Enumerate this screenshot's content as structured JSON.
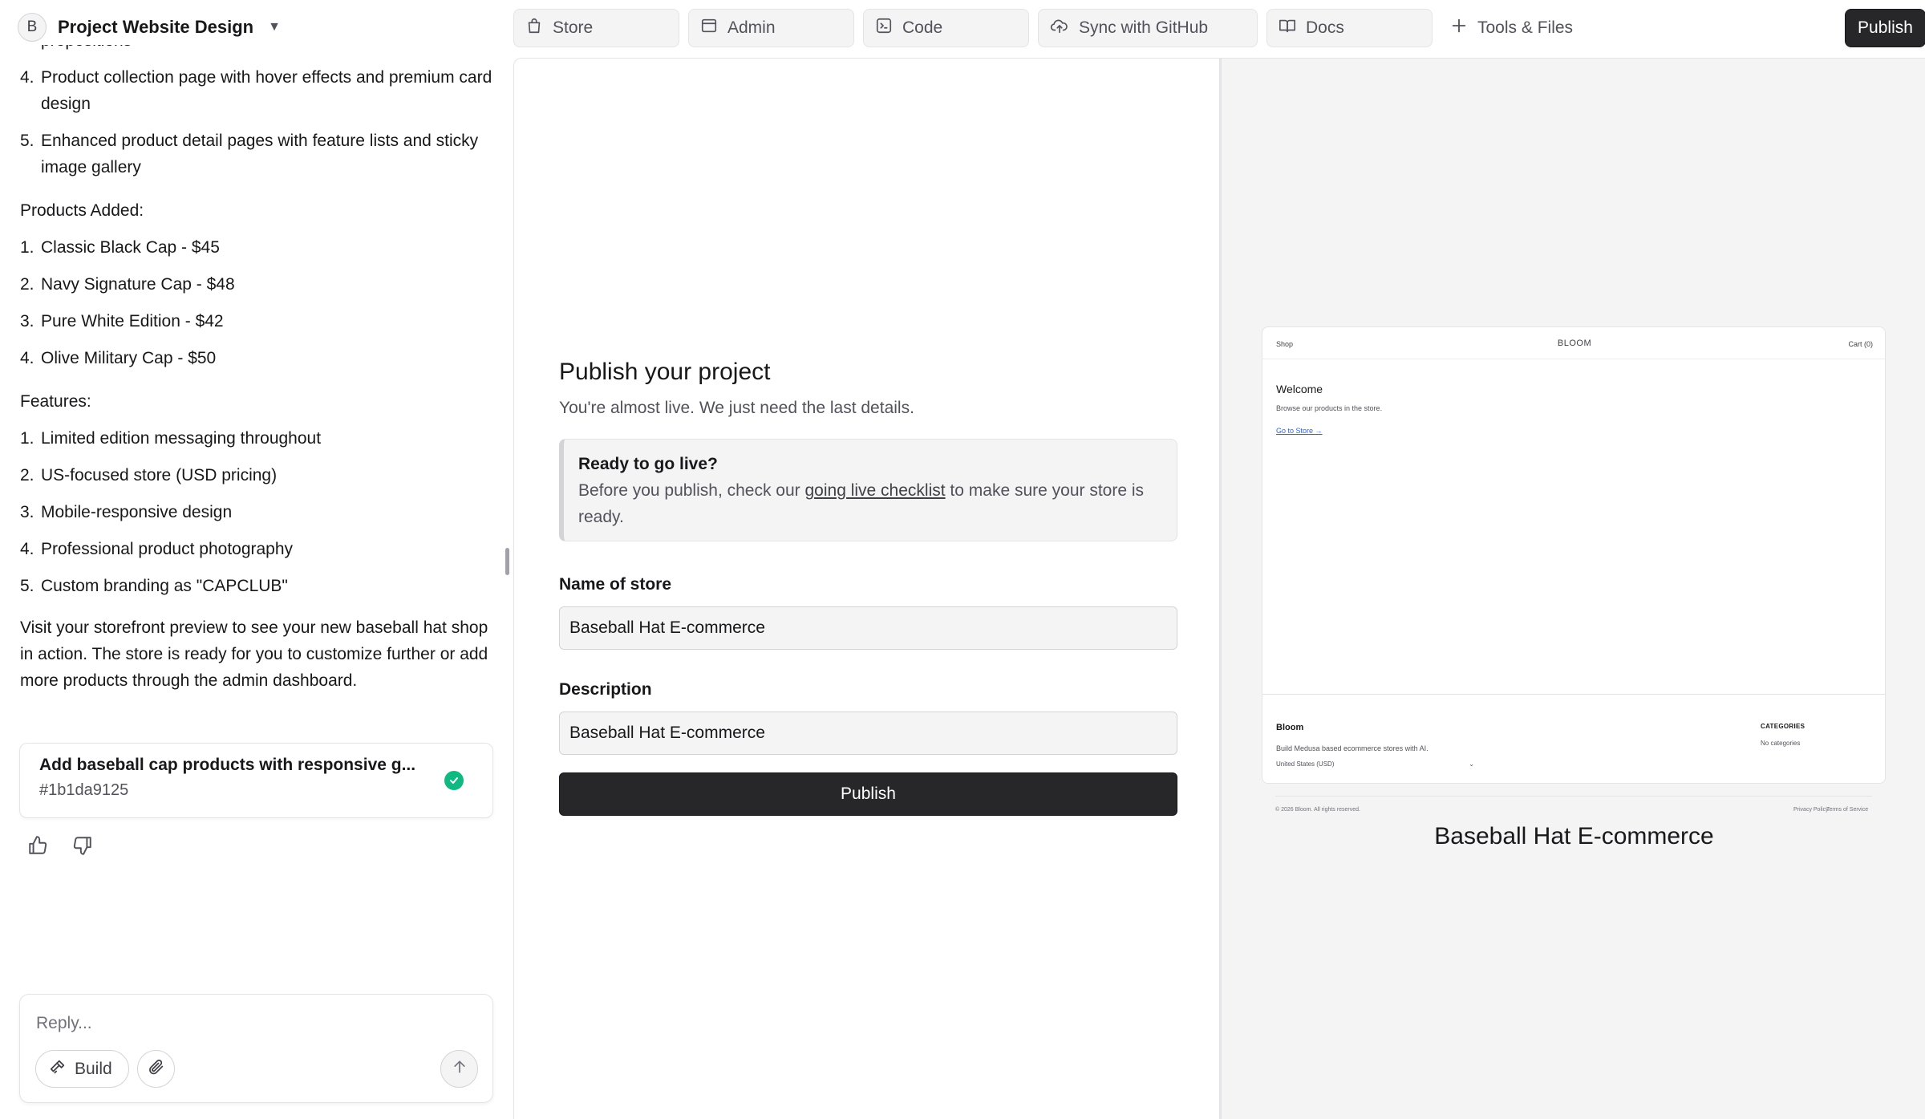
{
  "project": {
    "avatar_initial": "B",
    "title": "Project Website Design"
  },
  "chat": {
    "list_a": [
      {
        "num": "",
        "text": "propositions"
      },
      {
        "num": "4.",
        "text": "Product collection page with hover effects and premium card design"
      },
      {
        "num": "5.",
        "text": "Enhanced product detail pages with feature lists and sticky image gallery"
      }
    ],
    "products_heading": "Products Added:",
    "products": [
      {
        "num": "1.",
        "text": "Classic Black Cap - $45"
      },
      {
        "num": "2.",
        "text": "Navy Signature Cap - $48"
      },
      {
        "num": "3.",
        "text": "Pure White Edition - $42"
      },
      {
        "num": "4.",
        "text": "Olive Military Cap - $50"
      }
    ],
    "features_heading": "Features:",
    "features": [
      {
        "num": "1.",
        "text": "Limited edition messaging throughout"
      },
      {
        "num": "2.",
        "text": "US-focused store (USD pricing)"
      },
      {
        "num": "3.",
        "text": "Mobile-responsive design"
      },
      {
        "num": "4.",
        "text": "Professional product photography"
      },
      {
        "num": "5.",
        "text": "Custom branding as \"CAPCLUB\""
      }
    ],
    "closing": "Visit your storefront preview to see your new baseball hat shop in action. The store is ready for you to customize further or add more products through the admin dashboard."
  },
  "commit": {
    "title": "Add baseball cap products with responsive g...",
    "hash": "#1b1da9125"
  },
  "reply": {
    "placeholder": "Reply...",
    "build_label": "Build"
  },
  "toolbar": {
    "tabs": [
      "Store",
      "Admin",
      "Code",
      "Sync with GitHub",
      "Docs"
    ],
    "tools_label": "Tools & Files",
    "publish_label": "Publish"
  },
  "publish_form": {
    "title": "Publish your project",
    "subtitle": "You're almost live. We just need the last details.",
    "notice_title": "Ready to go live?",
    "notice_before": "Before you publish, check our ",
    "notice_link": "going live checklist",
    "notice_after": " to make sure your store is ready.",
    "store_name_label": "Name of store",
    "store_name_value": "Baseball Hat E-commerce",
    "description_label": "Description",
    "description_value": "Baseball Hat E-commerce",
    "publish_label": "Publish"
  },
  "storefront": {
    "nav_shop": "Shop",
    "brand": "BLOOM",
    "cart": "Cart (0)",
    "welcome": "Welcome",
    "welcome_desc": "Browse our products in the store.",
    "store_link": "Go to Store →",
    "footer_brand": "Bloom",
    "footer_tagline": "Build Medusa based ecommerce stores with AI.",
    "region": "United States (USD)",
    "categories_heading": "CATEGORIES",
    "categories_value": "No categories",
    "copyright": "© 2026 Bloom. All rights reserved.",
    "privacy": "Privacy Policy",
    "terms": "Terms of Service",
    "caption": "Baseball Hat E-commerce"
  },
  "colors": {
    "accent_dark": "#27272a",
    "success": "#10b981",
    "link_blue": "#2563eb"
  }
}
